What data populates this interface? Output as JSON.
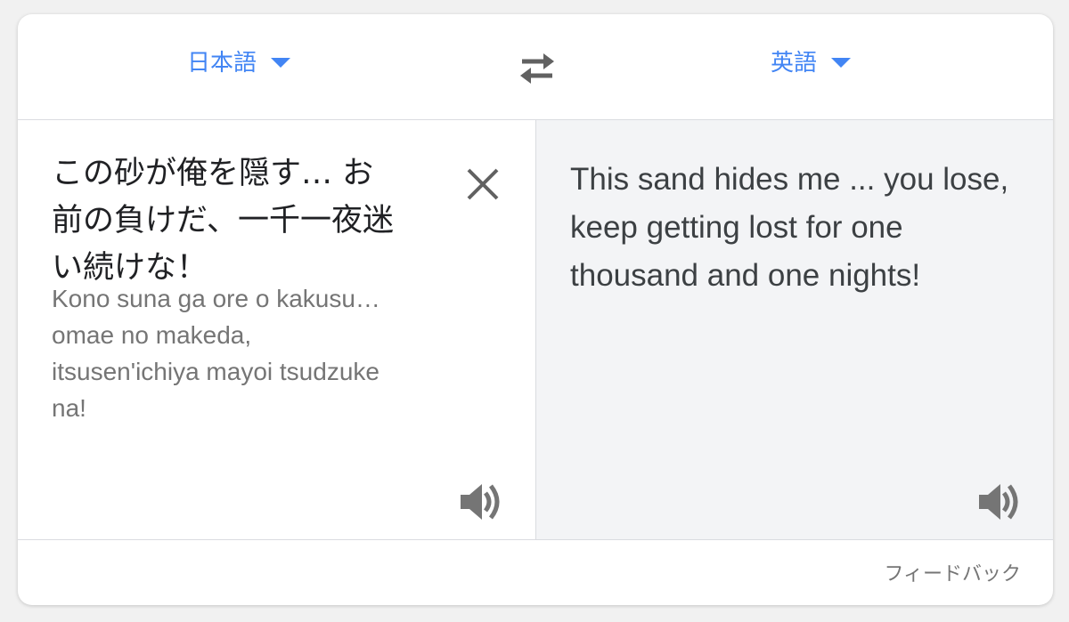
{
  "colors": {
    "accent": "#4285f4",
    "target_panel_bg": "#f3f4f6",
    "icon_gray": "#757575"
  },
  "language_bar": {
    "source_language": "日本語",
    "target_language": "英語",
    "swap_icon": "swap-arrows-icon",
    "dropdown_icon": "caret-down-icon"
  },
  "source_panel": {
    "text": "この砂が俺を隠す… お前の負けだ、一千一夜迷い続けな！",
    "transliteration": "Kono suna ga ore o kakusu… omae no makeda, itsusen'ichiya mayoi tsudzuke na!",
    "clear_icon": "close-icon",
    "listen_icon": "speaker-icon"
  },
  "target_panel": {
    "text": "This sand hides me ... you lose, keep getting lost for one thousand and one nights!",
    "listen_icon": "speaker-icon"
  },
  "footer": {
    "feedback_label": "フィードバック"
  }
}
